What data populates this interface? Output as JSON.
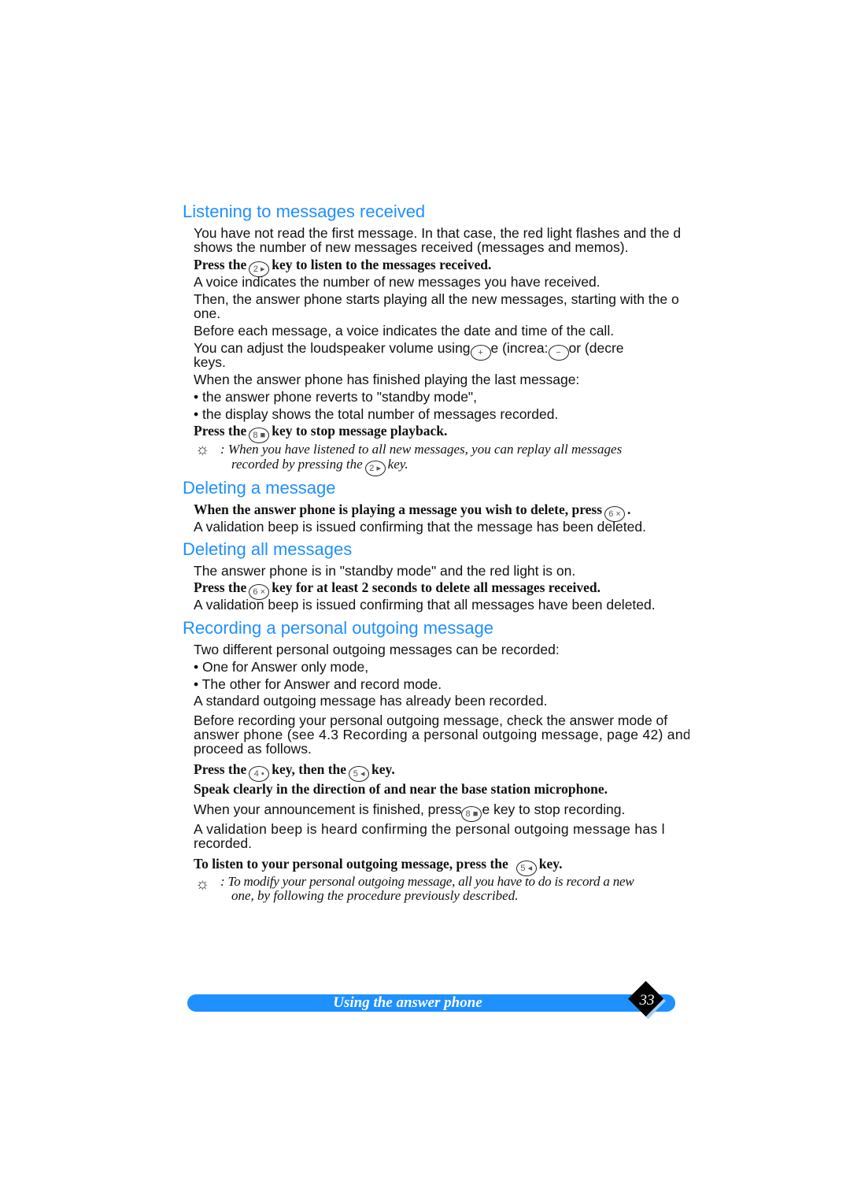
{
  "sections": [
    {
      "heading": "Listening to messages received"
    },
    {
      "heading": "Deleting a message"
    },
    {
      "heading": "Deleting all messages"
    },
    {
      "heading": "Recording a personal outgoing message"
    }
  ],
  "keys": {
    "k2": "2 ▸",
    "k8": "8 ■",
    "k6": "6 ×",
    "k4": "4 •",
    "k5": "5 ◂",
    "plus": "+",
    "minus": "−"
  },
  "text": {
    "l1": "You have not read the first message. In that case, the red light flashes and the d",
    "l2": "shows the number of new messages received (messages and memos).",
    "l3a": "Press the",
    "l3b": "key to listen to the messages received.",
    "l4": "A voice indicates the number of new messages you have received.",
    "l5": "Then, the answer phone starts playing all the new messages, starting with the o",
    "l6": "one.",
    "l7": "Before each message, a voice indicates the date and time of the call.",
    "l8a": "You can adjust the loudspeaker volume using",
    "l8b": "e      (increa:",
    "l8c": "or      (decre",
    "l9": "keys.",
    "l10": "When the answer phone has finished playing the last message:",
    "l11": "• the answer phone reverts to \"standby mode\",",
    "l12": "• the display shows the total number of messages recorded.",
    "l13a": "Press the",
    "l13b": "key to stop message playback.",
    "t1a": ": When you have listened to all new messages, you can replay all messages",
    "t1b": "recorded by pressing the",
    "t1c": "key.",
    "d1a": "When the answer phone is playing a message you wish to delete, press",
    "d1b": ".",
    "d2": "A validation beep is issued confirming that the message has been deleted.",
    "a1": "The answer phone is in \"standby mode\" and the red light is on.",
    "a2a": "Press the",
    "a2b": "key for at least 2 seconds to delete all messages received.",
    "a3": "A validation beep is issued confirming that all messages have been deleted.",
    "r1": "Two different personal outgoing messages can be recorded:",
    "r2": "• One for Answer only mode,",
    "r3": "• The other for Answer and record mode.",
    "r4": "A standard outgoing message has already been recorded.",
    "r5": "Before recording your personal outgoing message, check the answer mode of",
    "r6": "answer phone (see 4.3 Recording a personal outgoing message, page 42) and",
    "r7": "proceed as follows.",
    "r8a": "Press the",
    "r8b": "key, then the",
    "r8c": "key.",
    "r9": "Speak clearly in the direction of and near the base station microphone.",
    "r10a": "When your announcement is finished, press",
    "r10b": "e        key to stop recording.",
    "r11": "A validation beep is heard confirming the personal outgoing message has l",
    "r12": "recorded.",
    "r13a": "To listen to your personal outgoing message, press the",
    "r13b": "key.",
    "t2a": ": To modify your personal outgoing message, all you have to do is record a new",
    "t2b": "one, by following the procedure previously described."
  },
  "footer": {
    "title": "Using the answer phone",
    "page": "33"
  },
  "colors": {
    "heading": "#1e90ff",
    "footer_bar": "#1e90ff"
  }
}
